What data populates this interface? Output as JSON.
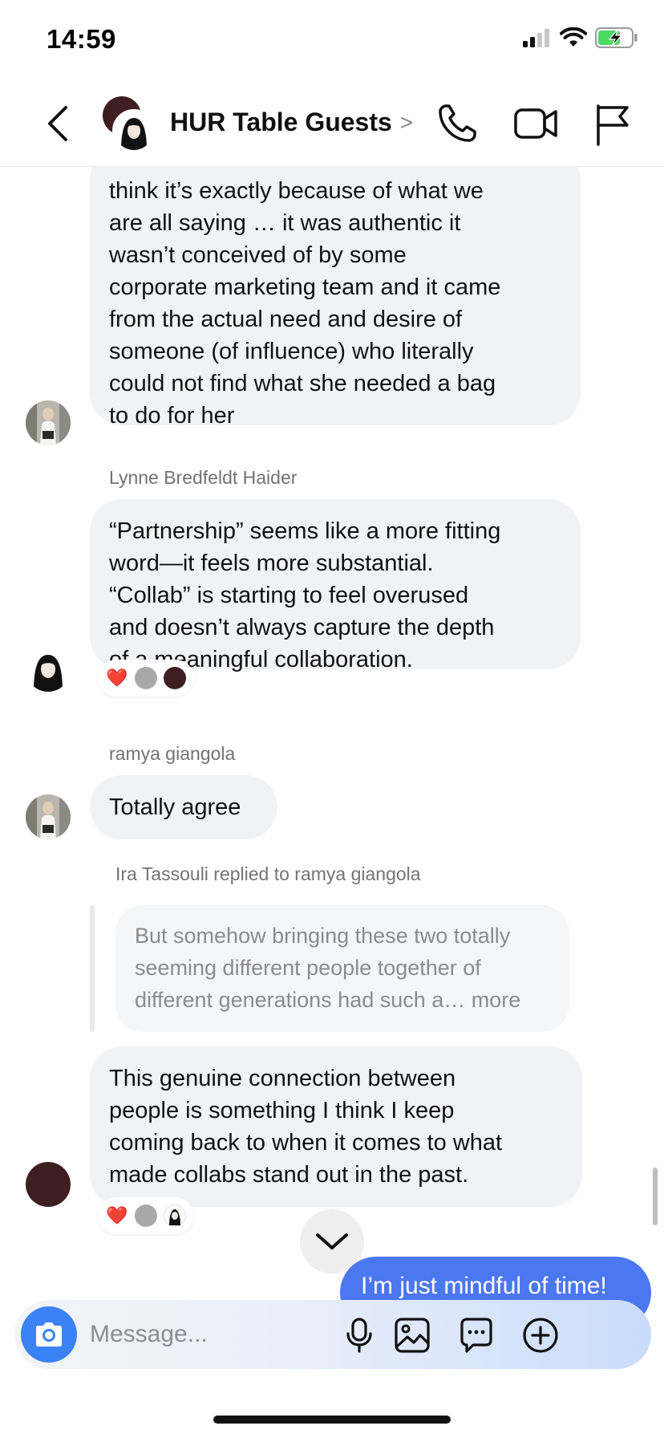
{
  "status_bar": {
    "time": "14:59"
  },
  "header": {
    "title": "HUR Table Guests",
    "chevron": ">",
    "icons": [
      "back-icon",
      "phone-icon",
      "video-icon",
      "flag-icon"
    ]
  },
  "messages": [
    {
      "partial_text": "think it’s exactly because of what we are all saying … it was authentic it wasn’t conceived of by some corporate marketing team and it came from the actual need and desire of someone (of influence) who literally could not find what she needed a bag to do for her",
      "lines": [
        "think it’s exactly because of what we",
        "are all saying … it was authentic it",
        "wasn’t conceived of by some",
        "corporate marketing team and it came",
        "from the actual need and desire of",
        "someone (of influence) who literally",
        "could not find what she needed a bag",
        "to do for her"
      ]
    },
    {
      "sender": "Lynne Bredfeldt Haider",
      "lines": [
        "“Partnership” seems like a more fitting",
        "word—it feels more substantial.",
        "“Collab” is starting to feel overused",
        "and doesn’t always capture the depth",
        "of a meaningful collaboration."
      ],
      "reactions": [
        "❤️"
      ]
    },
    {
      "sender": "ramya giangola",
      "lines": [
        "Totally agree"
      ]
    },
    {
      "reply_header": "Ira Tassouli replied to ramya giangola",
      "quoted_lines": [
        "But somehow bringing these two totally",
        "seeming different people together of",
        "different generations had such a… more"
      ],
      "lines": [
        "This genuine connection between",
        "people is something I think I keep",
        "coming back to when it comes to what",
        "made collabs stand out in the past."
      ],
      "reactions": [
        "❤️"
      ]
    }
  ],
  "outgoing": {
    "text": "I’m just mindful of time!"
  },
  "composer": {
    "placeholder": "Message...",
    "icons": [
      "camera-icon",
      "microphone-icon",
      "gallery-icon",
      "sticker-icon",
      "plus-icon"
    ]
  },
  "colors": {
    "accent": "#3b82f6",
    "outgoing_bubble": "#4c77f2",
    "incoming_bubble": "#f1f2f5"
  }
}
